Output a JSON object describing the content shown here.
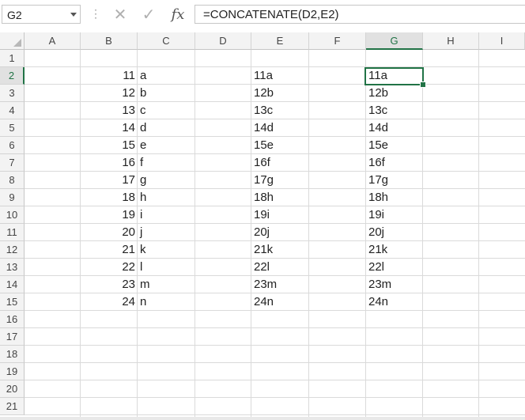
{
  "name_box": {
    "value": "G2"
  },
  "formula_bar": {
    "dots": "⋮",
    "cancel_icon": "✕",
    "enter_icon": "✓",
    "fx_label": "fx",
    "formula": "=CONCATENATE(D2,E2)"
  },
  "selected_cell": "G2",
  "accent_color": "#217346",
  "columns": [
    "A",
    "B",
    "C",
    "D",
    "E",
    "F",
    "G",
    "H",
    "I"
  ],
  "rows": [
    "1",
    "2",
    "3",
    "4",
    "5",
    "6",
    "7",
    "8",
    "9",
    "10",
    "11",
    "12",
    "13",
    "14",
    "15",
    "16",
    "17",
    "18",
    "19",
    "20",
    "21"
  ],
  "column_b": [
    "11",
    "12",
    "13",
    "14",
    "15",
    "16",
    "17",
    "18",
    "19",
    "20",
    "21",
    "22",
    "23",
    "24"
  ],
  "column_c": [
    "a",
    "b",
    "c",
    "d",
    "e",
    "f",
    "g",
    "h",
    "i",
    "j",
    "k",
    "l",
    "m",
    "n"
  ],
  "column_e": [
    "11a",
    "12b",
    "13c",
    "14d",
    "15e",
    "16f",
    "17g",
    "18h",
    "19i",
    "20j",
    "21k",
    "22l",
    "23m",
    "24n"
  ],
  "column_g": [
    "11a",
    "12b",
    "13c",
    "14d",
    "15e",
    "16f",
    "17g",
    "18h",
    "19i",
    "20j",
    "21k",
    "22l",
    "23m",
    "24n"
  ]
}
